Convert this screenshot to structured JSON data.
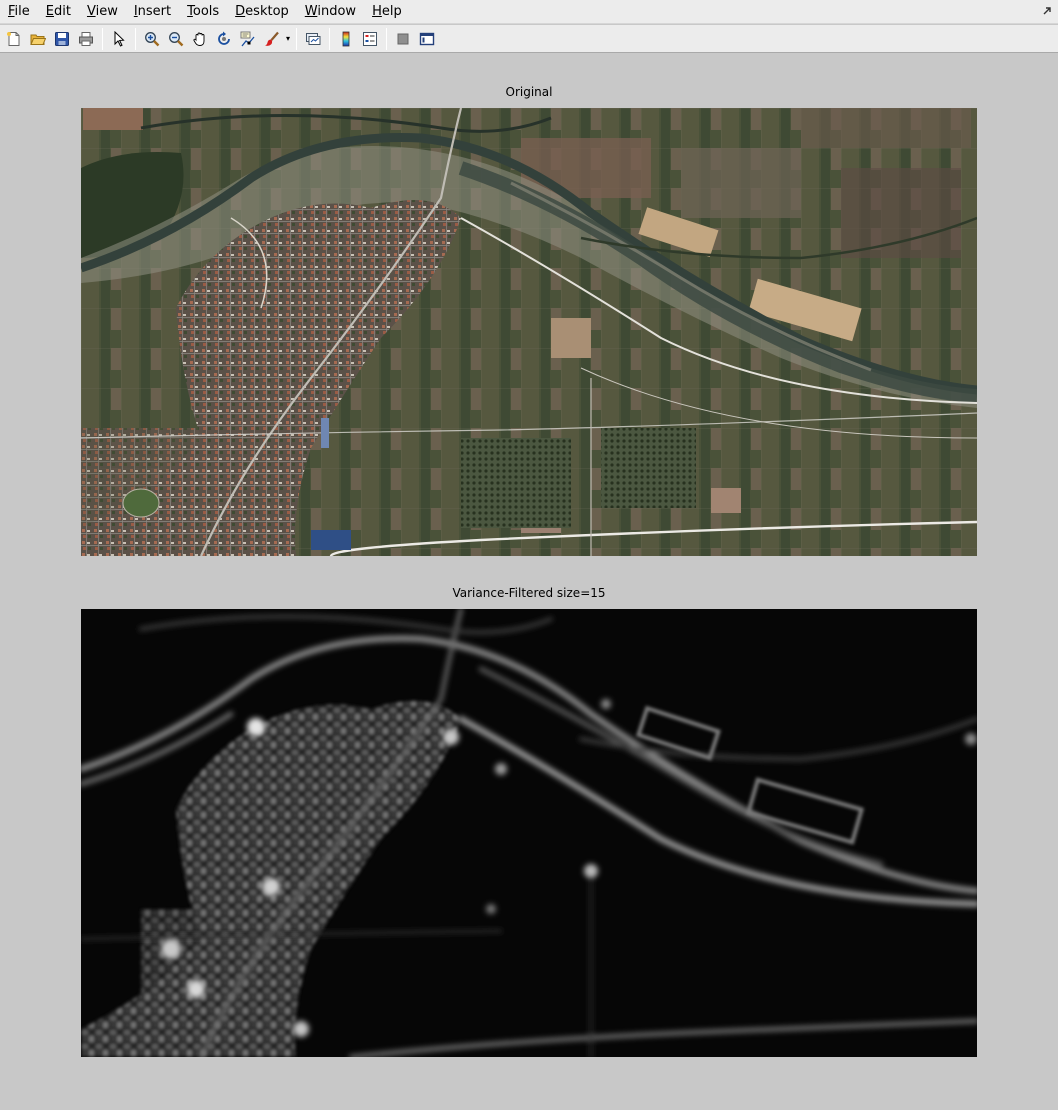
{
  "menu": {
    "items": [
      {
        "mnemonic": "F",
        "rest": "ile"
      },
      {
        "mnemonic": "E",
        "rest": "dit"
      },
      {
        "mnemonic": "V",
        "rest": "iew"
      },
      {
        "mnemonic": "I",
        "rest": "nsert"
      },
      {
        "mnemonic": "T",
        "rest": "ools"
      },
      {
        "mnemonic": "D",
        "rest": "esktop"
      },
      {
        "mnemonic": "W",
        "rest": "indow"
      },
      {
        "mnemonic": "H",
        "rest": "elp"
      }
    ]
  },
  "toolbar": {
    "icons": [
      "new-figure-icon",
      "open-file-icon",
      "save-figure-icon",
      "print-figure-icon",
      "edit-plot-icon",
      "zoom-in-icon",
      "zoom-out-icon",
      "pan-icon",
      "rotate-3d-icon",
      "data-cursor-icon",
      "brush-icon",
      "link-plot-icon",
      "insert-colorbar-icon",
      "insert-legend-icon",
      "hide-plot-tools-icon",
      "show-plot-tools-icon"
    ]
  },
  "figure": {
    "axes_top": {
      "title": "Original",
      "image": "Satellite image of a town beside a braided river with agricultural fields"
    },
    "axes_bottom": {
      "title": "Variance-Filtered size=15",
      "image": "Grayscale local variance map of the same scene"
    }
  },
  "colors": {
    "figure_bg": "#c8c8c8",
    "menubar_bg": "#ececec",
    "river": "#3c4a3e",
    "field_dark": "#3e4a33",
    "field_brown": "#7a6a55",
    "variance_bg": "#050505"
  }
}
